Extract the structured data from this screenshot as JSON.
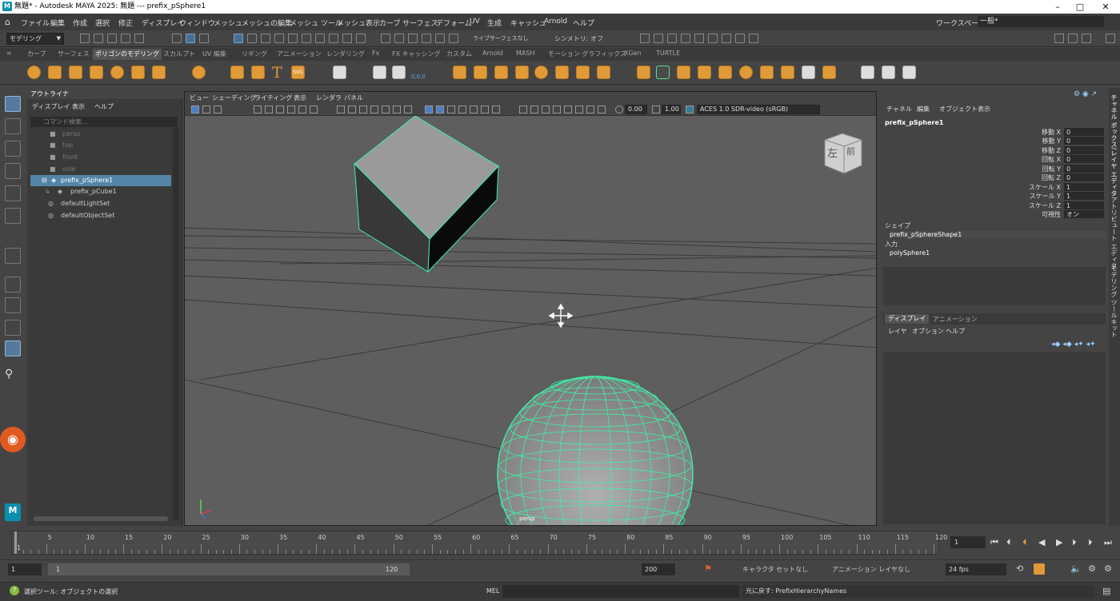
{
  "window": {
    "title": "無題* - Autodesk MAYA 2025: 無題   ---   prefix_pSphere1",
    "minimize": "–",
    "maximize": "□",
    "close": "✕"
  },
  "menubar": {
    "items": [
      "ファイル",
      "編集",
      "作成",
      "選択",
      "修正",
      "ディスプレイ",
      "ウィンドウ",
      "メッシュ",
      "メッシュの編集",
      "メッシュ ツール",
      "メッシュ表示",
      "カーブ",
      "サーフェス",
      "デフォーム",
      "UV",
      "生成",
      "キャッシュ",
      "Arnold",
      "ヘルプ"
    ],
    "workspace_label": "ワークスペース:",
    "workspace_value": "一般*"
  },
  "statusline": {
    "mode": "モデリング",
    "live_label": "ライブ",
    "live_value": "サーフェスなし",
    "symmetry": "シンメトリ: オフ"
  },
  "shelf": {
    "tabs": [
      "カーブ",
      "サーフェス",
      "ポリゴンのモデリング",
      "スカルプト",
      "UV 編集",
      "リギング",
      "アニメーション",
      "レンダリング",
      "Fx",
      "FX キャッシング",
      "カスタム",
      "Arnold",
      "MASH",
      "モーション グラフィックス",
      "XGen",
      "TURTLE"
    ],
    "active_tab": "ポリゴンのモデリング",
    "text_icon": "T",
    "svg_icon": "SVG",
    "coord_icon": "0,0,0"
  },
  "outliner": {
    "title": "アウトライナ",
    "menu": [
      "ディスプレイ",
      "表示",
      "ヘルプ"
    ],
    "search_placeholder": "コマンド検索...",
    "items": [
      {
        "label": "persp",
        "state": "dim"
      },
      {
        "label": "top",
        "state": "dim"
      },
      {
        "label": "front",
        "state": "dim"
      },
      {
        "label": "side",
        "state": "dim"
      },
      {
        "label": "prefix_pSphere1",
        "state": "selected"
      },
      {
        "label": "prefix_pCube1",
        "state": "child"
      },
      {
        "label": "defaultLightSet",
        "state": "normal"
      },
      {
        "label": "defaultObjectSet",
        "state": "normal"
      }
    ]
  },
  "viewport": {
    "menu": [
      "ビュー",
      "シェーディング",
      "ライティング",
      "表示",
      "レンダラ",
      "パネル"
    ],
    "exposure": "0.00",
    "gamma": "1.00",
    "color_space": "ACES 1.0 SDR-video (sRGB)",
    "camera_label": "persp",
    "viewcube_left": "左",
    "viewcube_front": "前"
  },
  "channelbox": {
    "menu": [
      "チャネル",
      "編集",
      "オブジェクト",
      "表示"
    ],
    "object_name": "prefix_pSphere1",
    "attributes": [
      {
        "name": "移動 X",
        "value": "0"
      },
      {
        "name": "移動 Y",
        "value": "0"
      },
      {
        "name": "移動 Z",
        "value": "0"
      },
      {
        "name": "回転 X",
        "value": "0"
      },
      {
        "name": "回転 Y",
        "value": "0"
      },
      {
        "name": "回転 Z",
        "value": "0"
      },
      {
        "name": "スケール X",
        "value": "1"
      },
      {
        "name": "スケール Y",
        "value": "1"
      },
      {
        "name": "スケール Z",
        "value": "1"
      },
      {
        "name": "可視性",
        "value": "オン"
      }
    ],
    "shapes_label": "シェイプ",
    "shape_name": "prefix_pSphereShape1",
    "inputs_label": "入力",
    "input_name": "polySphere1"
  },
  "layereditor": {
    "tabs": [
      "ディスプレイ",
      "アニメーション"
    ],
    "menu": [
      "レイヤ",
      "オプション",
      "ヘルプ"
    ]
  },
  "side_tabs": [
    "チャネル ボックス/レイヤ エディタ",
    "アトリビュート エディタ",
    "モデリング ツールキット"
  ],
  "timeline": {
    "ticks": [
      "1",
      "5",
      "10",
      "15",
      "20",
      "25",
      "30",
      "35",
      "40",
      "45",
      "50",
      "55",
      "60",
      "65",
      "70",
      "75",
      "80",
      "85",
      "90",
      "95",
      "100",
      "105",
      "110",
      "115",
      "120"
    ],
    "current_frame": "1"
  },
  "range": {
    "start": "1",
    "playback_start": "1",
    "playback_end": "120",
    "end": "200",
    "character_set": "キャラクタ セットなし",
    "anim_layer": "アニメーション レイヤなし",
    "fps": "24 fps"
  },
  "commandline": {
    "help_text": "選択ツール: オブジェクトの選択",
    "lang": "MEL",
    "result": "元に戻す: PrefixHierarchyNames"
  },
  "colors": {
    "selection_wire": "#3df0a8",
    "shelf_icon": "#e09a38",
    "outliner_selected": "#5285a6"
  }
}
